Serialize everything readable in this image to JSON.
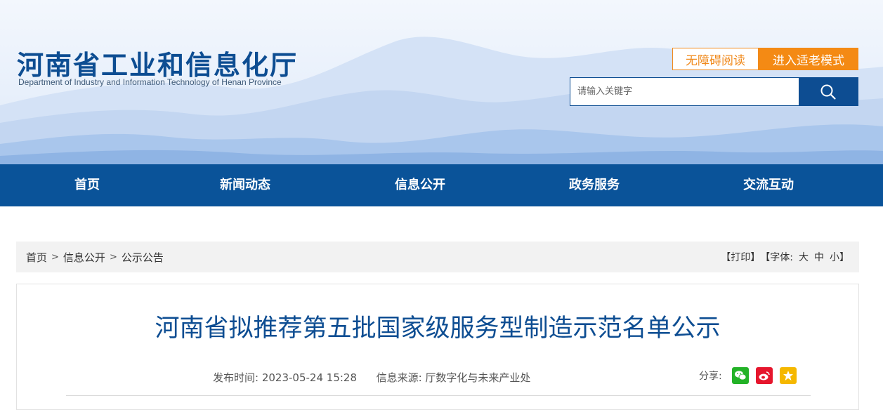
{
  "header": {
    "title": "河南省工业和信息化厅",
    "subtitle": "Department of Industry and Information Technology of Henan Province",
    "accessible_label": "无障碍阅读",
    "elder_mode_label": "进入适老模式"
  },
  "search": {
    "placeholder": "请输入关键字",
    "icon": "search-icon"
  },
  "nav": {
    "items": [
      {
        "label": "首页"
      },
      {
        "label": "新闻动态"
      },
      {
        "label": "信息公开"
      },
      {
        "label": "政务服务"
      },
      {
        "label": "交流互动"
      }
    ]
  },
  "breadcrumb": {
    "items": [
      "首页",
      "信息公开",
      "公示公告"
    ],
    "separator": ">"
  },
  "tools": {
    "print": "【打印】",
    "font_prefix": "【字体:",
    "font_large": "大",
    "font_medium": "中",
    "font_small": "小",
    "font_suffix": "】"
  },
  "article": {
    "title": "河南省拟推荐第五批国家级服务型制造示范名单公示",
    "publish_label": "发布时间:",
    "publish_time": "2023-05-24 15:28",
    "source_label": "信息来源:",
    "source": "厅数字化与未来产业处",
    "share_label": "分享:"
  },
  "colors": {
    "brand_blue": "#0d4d92",
    "nav_blue": "#0a5399",
    "orange": "#f48a14",
    "wechat_green": "#23b227",
    "weibo_red": "#e6162d",
    "qzone_yellow": "#f5b800"
  }
}
